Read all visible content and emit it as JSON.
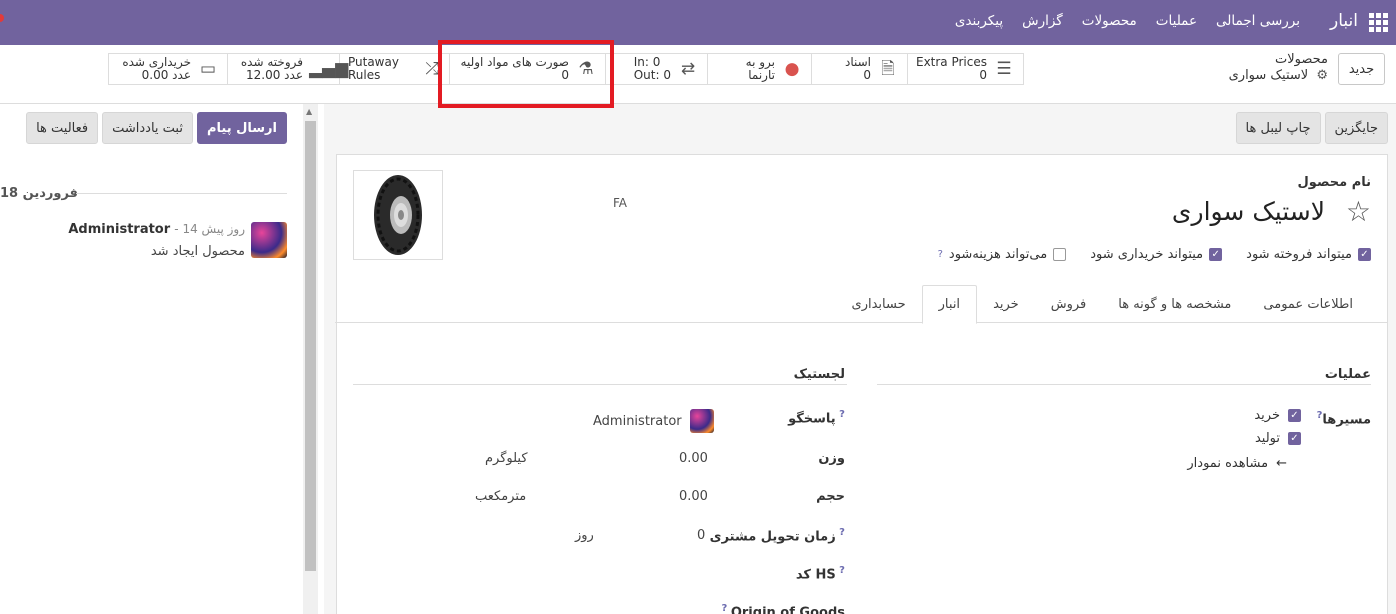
{
  "navbar": {
    "brand": "انبار",
    "menu": [
      "بررسی اجمالی",
      "عملیات",
      "محصولات",
      "گزارش",
      "پیکربندی"
    ]
  },
  "control_panel": {
    "new_label": "جدید",
    "breadcrumb_parent": "محصولات",
    "breadcrumb_current": "لاستیک سواری",
    "stat_buttons": [
      {
        "icon": "list-icon",
        "label": "Extra Prices",
        "value": "0"
      },
      {
        "icon": "document-icon",
        "label": "اسناد",
        "value": "0"
      },
      {
        "icon": "globe-icon",
        "label": "برو به",
        "value": "تارنما"
      },
      {
        "icon": "transfer-icon",
        "label": "In: 0",
        "value": "Out: 0"
      },
      {
        "icon": "flask-icon",
        "label": "صورت های مواد اولیه",
        "value": "0"
      },
      {
        "icon": "shuffle-icon",
        "label": "Putaway Rules",
        "value": ""
      },
      {
        "icon": "chart-icon",
        "label": "فروخته شده",
        "value": "12.00 عدد"
      },
      {
        "icon": "card-icon",
        "label": "خریداری شده",
        "value": "0.00 عدد"
      }
    ]
  },
  "form": {
    "action_buttons": [
      "جایگزین",
      "چاپ لیبل ها"
    ],
    "lang": "FA",
    "name_label": "نام محصول",
    "name": "لاستیک سواری",
    "checkboxes": [
      {
        "label": "میتواند فروخته شود",
        "checked": true
      },
      {
        "label": "میتواند خریداری شود",
        "checked": true
      },
      {
        "label": "می‌تواند هزینه‌شود",
        "checked": false
      }
    ],
    "tabs": [
      "اطلاعات عمومی",
      "مشخصه ها و گونه ها",
      "فروش",
      "خرید",
      "انبار",
      "حسابداری"
    ],
    "active_tab": "انبار",
    "operations": {
      "title": "عملیات",
      "routes_label": "مسیرها",
      "routes": [
        {
          "label": "خرید",
          "checked": true
        },
        {
          "label": "تولید",
          "checked": true
        }
      ],
      "diagram_link": "مشاهده نمودار"
    },
    "logistics": {
      "title": "لجستیک",
      "responsible_label": "پاسخگو",
      "responsible_value": "Administrator",
      "weight_label": "وزن",
      "weight_value": "0.00",
      "weight_unit": "کیلوگرم",
      "volume_label": "حجم",
      "volume_value": "0.00",
      "volume_unit": "مترمکعب",
      "lead_label": "زمان تحویل مشتری",
      "lead_value": "0",
      "lead_unit": "روز",
      "hs_label": "کد HS",
      "origin_label": "Origin of Goods"
    }
  },
  "chatter": {
    "buttons": [
      "ارسال پیام",
      "ثبت یادداشت",
      "فعالیت ها"
    ],
    "date": "18 فروردین",
    "author": "Administrator",
    "when": "- 14 روز پیش",
    "body": "محصول ایجاد شد"
  },
  "colors": {
    "brand": "#71639e",
    "highlight": "#e31b23"
  }
}
